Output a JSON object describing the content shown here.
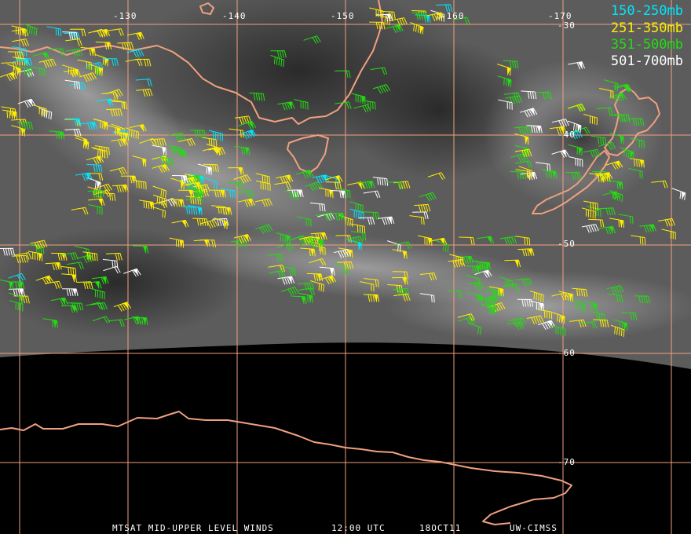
{
  "map": {
    "longitude_labels": [
      "-130",
      "-140",
      "-150",
      "-160",
      "-170"
    ],
    "latitude_labels": [
      "-30",
      "-40",
      "-50",
      "-60",
      "-70"
    ],
    "colors": {
      "background": "#000000",
      "graticule": "#f0a080",
      "coastline": "#f0a080",
      "label_text": "#ffffff"
    }
  },
  "legend": [
    {
      "label": "150-250mb",
      "color": "#00e6ff"
    },
    {
      "label": "251-350mb",
      "color": "#ffee00"
    },
    {
      "label": "351-500mb",
      "color": "#22dd11"
    },
    {
      "label": "501-700mb",
      "color": "#ffffff"
    }
  ],
  "footer": {
    "product": "MTSAT MID-UPPER LEVEL WINDS",
    "time": "12:00 UTC",
    "date": "18OCT11",
    "source": "UW-CIMSS"
  }
}
